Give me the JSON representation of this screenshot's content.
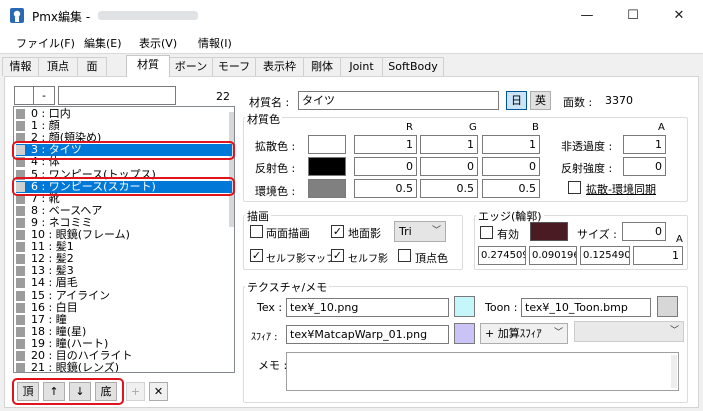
{
  "window": {
    "title": "Pmx編集 -",
    "minimize_glyph": "—",
    "maximize_glyph": "☐",
    "close_glyph": "✕"
  },
  "menu": [
    "ファイル(F)",
    "編集(E)",
    "表示(V)",
    "情報(I)"
  ],
  "tabs": [
    "情報",
    "頂点",
    "面",
    "材質",
    "ボーン",
    "モーフ",
    "表示枠",
    "剛体",
    "Joint",
    "SoftBody"
  ],
  "active_tab": "材質",
  "left": {
    "filter_value": "",
    "mode_value": "-",
    "search_value": "",
    "count": "22",
    "items": [
      "0 : 口内",
      "1 : 顔",
      "2 : 顔(頬染め)",
      "3 : タイツ",
      "4 : 体",
      "5 : ワンピース(トップス)",
      "6 : ワンピース(スカート)",
      "7 : 靴",
      "8 : ベースヘア",
      "9 : ネコミミ",
      "10 : 眼鏡(フレーム)",
      "11 : 髪1",
      "12 : 髪2",
      "13 : 髪3",
      "14 : 眉毛",
      "15 : アイライン",
      "16 : 白目",
      "17 : 瞳",
      "18 : 瞳(星)",
      "19 : 瞳(ハート)",
      "20 : 目のハイライト",
      "21 : 眼鏡(レンズ)"
    ],
    "selected": [
      "3 : タイツ",
      "6 : ワンピース(スカート)"
    ],
    "buttons": {
      "top": "頂",
      "up": "↑",
      "down": "↓",
      "bottom": "底",
      "add": "+",
      "delete": "✕"
    }
  },
  "material": {
    "name_label": "材質名 :",
    "name_value": "タイツ",
    "lang_jp": "日",
    "lang_en": "英",
    "face_count_label": "面数 :",
    "face_count": "3370"
  },
  "color_section": {
    "title": "材質色",
    "headers": {
      "r": "R",
      "g": "G",
      "b": "B",
      "a": "A"
    },
    "diffuse": {
      "label": "拡散色 :",
      "swatch": "#ffffff",
      "r": "1",
      "g": "1",
      "b": "1"
    },
    "specular": {
      "label": "反射色 :",
      "swatch": "#000000",
      "r": "0",
      "g": "0",
      "b": "0"
    },
    "ambient": {
      "label": "環境色 :",
      "swatch": "#808080",
      "r": "0.5",
      "g": "0.5",
      "b": "0.5"
    },
    "opacity": {
      "label": "非透過度 :",
      "value": "1"
    },
    "spec_power": {
      "label": "反射強度 :",
      "value": "0"
    },
    "sync": {
      "label": "拡散-環境同期",
      "checked": false
    }
  },
  "draw_section": {
    "title": "描画",
    "double_sided": {
      "label": "両面描画",
      "checked": false
    },
    "ground_shadow": {
      "label": "地面影",
      "checked": true
    },
    "primitive": "Tri",
    "self_shadow_map": {
      "label": "セルフ影マップ",
      "checked": true
    },
    "self_shadow": {
      "label": "セルフ影",
      "checked": true
    },
    "vertex_color": {
      "label": "頂点色",
      "checked": false
    }
  },
  "edge_section": {
    "title": "エッジ(輪郭)",
    "enabled": {
      "label": "有効",
      "checked": false
    },
    "color": "#4a1b22",
    "size_label": "サイズ :",
    "size": "0",
    "a_header": "A",
    "r": "0.274509",
    "g": "0.090196",
    "b": "0.125490",
    "a": "1"
  },
  "texture_section": {
    "title": "テクスチャ/メモ",
    "tex_label": "Tex :",
    "tex_value": "tex¥_10.png",
    "tex_color": "#c4f6fa",
    "toon_label": "Toon :",
    "toon_value": "tex¥_10_Toon.bmp",
    "toon_color": "#d7d7d7",
    "sphere_label": "ｽﾌｨｱ :",
    "sphere_value": "tex¥MatcapWarp_01.png",
    "sphere_color": "#c9c3f6",
    "sphere_mode": "+ 加算ｽﾌｨｱ",
    "toon_select": "",
    "memo_label": "メモ :",
    "memo_value": ""
  }
}
